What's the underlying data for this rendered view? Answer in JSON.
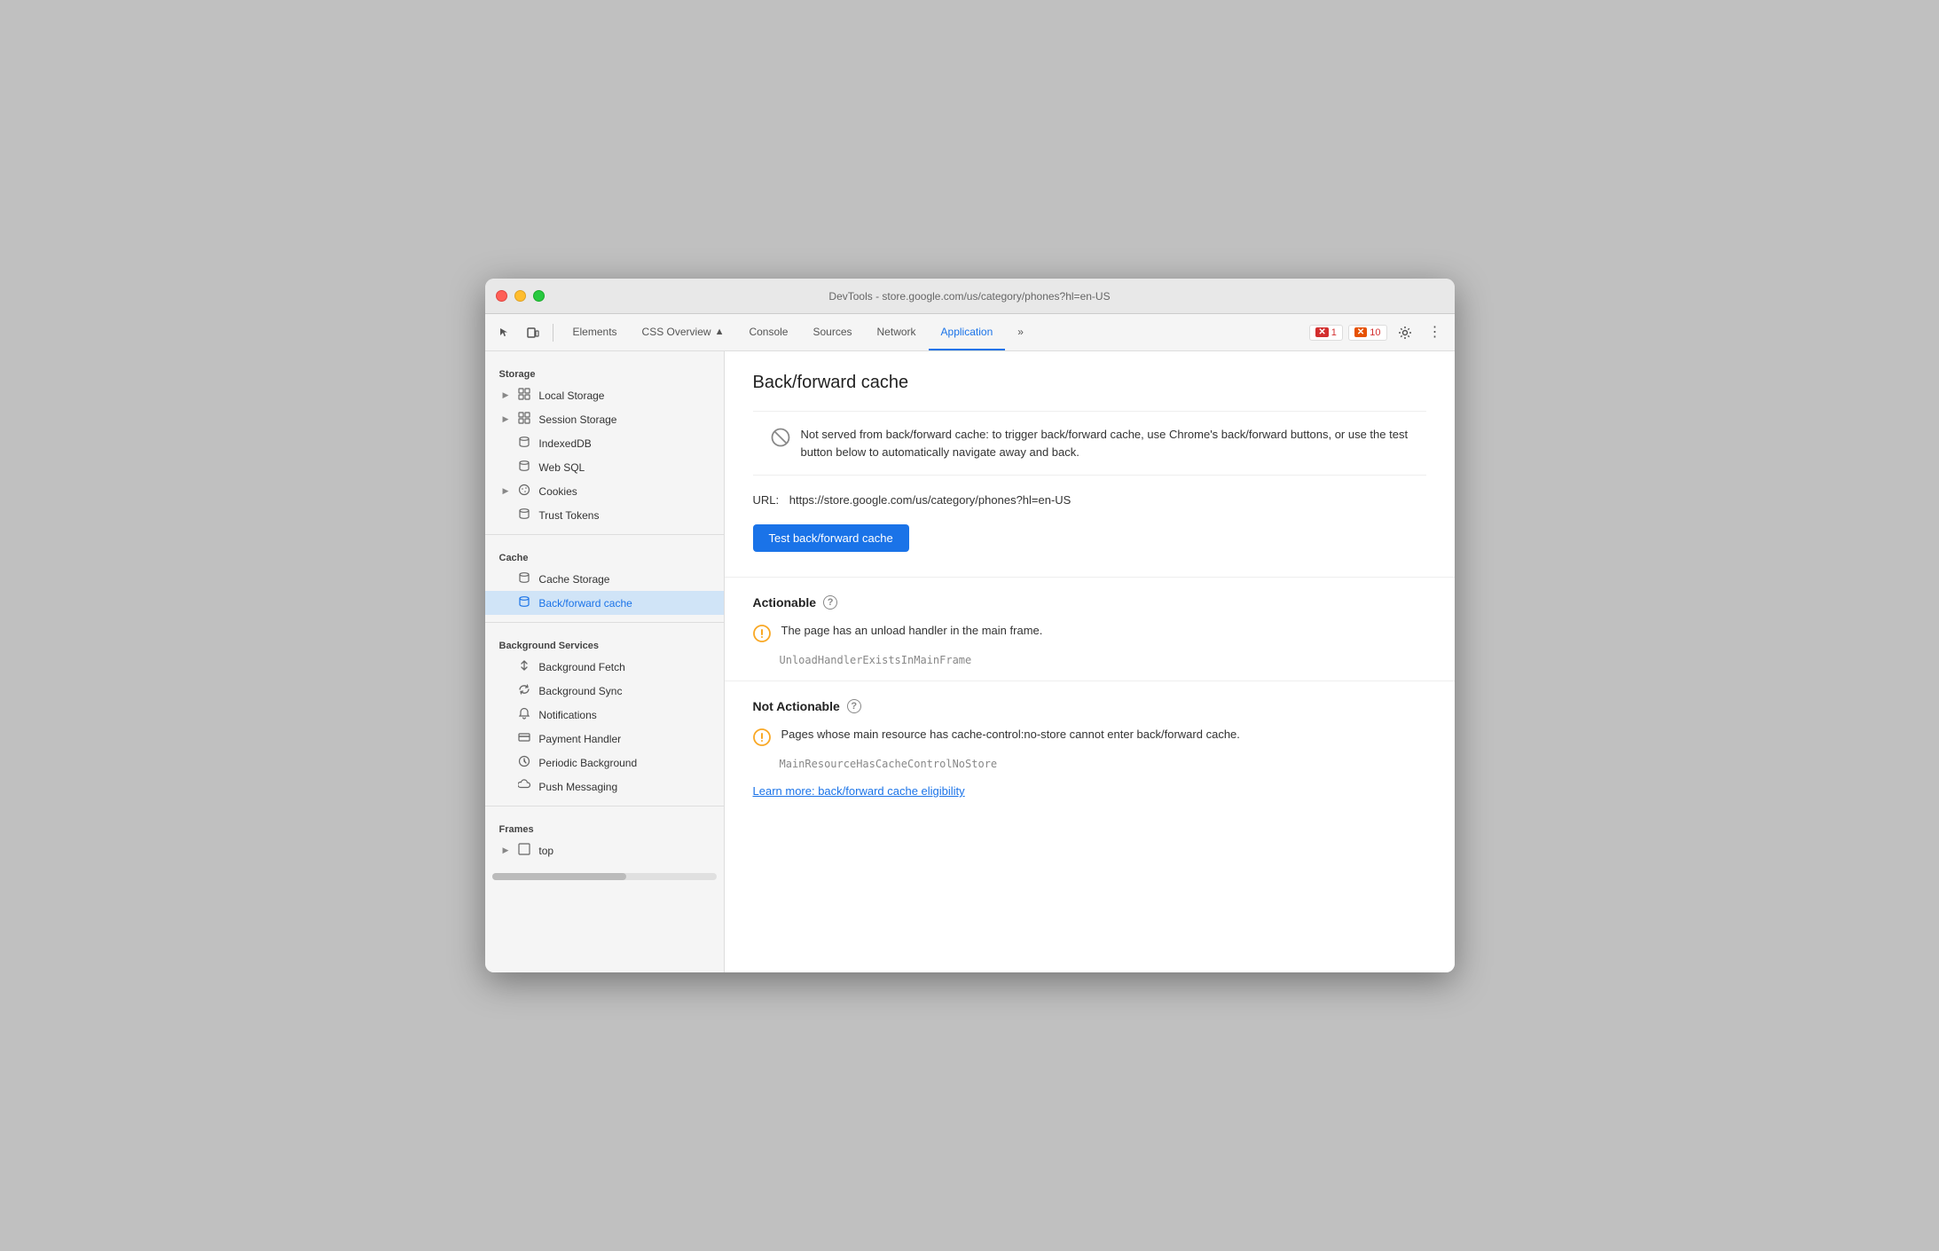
{
  "window": {
    "title": "DevTools - store.google.com/us/category/phones?hl=en-US"
  },
  "toolbar": {
    "tabs": [
      {
        "id": "elements",
        "label": "Elements",
        "active": false
      },
      {
        "id": "css-overview",
        "label": "CSS Overview",
        "active": false
      },
      {
        "id": "console",
        "label": "Console",
        "active": false
      },
      {
        "id": "sources",
        "label": "Sources",
        "active": false
      },
      {
        "id": "network",
        "label": "Network",
        "active": false
      },
      {
        "id": "application",
        "label": "Application",
        "active": true
      }
    ],
    "error_count": "1",
    "warning_count": "10",
    "more_label": "»"
  },
  "sidebar": {
    "storage_label": "Storage",
    "items": [
      {
        "id": "local-storage",
        "label": "Local Storage",
        "icon": "grid",
        "expandable": true
      },
      {
        "id": "session-storage",
        "label": "Session Storage",
        "icon": "grid",
        "expandable": true
      },
      {
        "id": "indexeddb",
        "label": "IndexedDB",
        "icon": "cylinder",
        "expandable": false
      },
      {
        "id": "web-sql",
        "label": "Web SQL",
        "icon": "cylinder",
        "expandable": false
      },
      {
        "id": "cookies",
        "label": "Cookies",
        "icon": "cookie",
        "expandable": true
      },
      {
        "id": "trust-tokens",
        "label": "Trust Tokens",
        "icon": "cylinder",
        "expandable": false
      }
    ],
    "cache_label": "Cache",
    "cache_items": [
      {
        "id": "cache-storage",
        "label": "Cache Storage",
        "icon": "cylinder",
        "active": false
      },
      {
        "id": "back-forward-cache",
        "label": "Back/forward cache",
        "icon": "cylinder",
        "active": true
      }
    ],
    "bg_services_label": "Background Services",
    "bg_items": [
      {
        "id": "background-fetch",
        "label": "Background Fetch",
        "icon": "arrows"
      },
      {
        "id": "background-sync",
        "label": "Background Sync",
        "icon": "sync"
      },
      {
        "id": "notifications",
        "label": "Notifications",
        "icon": "bell"
      },
      {
        "id": "payment-handler",
        "label": "Payment Handler",
        "icon": "card"
      },
      {
        "id": "periodic-background",
        "label": "Periodic Background",
        "icon": "clock"
      },
      {
        "id": "push-messaging",
        "label": "Push Messaging",
        "icon": "cloud"
      }
    ],
    "frames_label": "Frames",
    "frames_items": [
      {
        "id": "top",
        "label": "top",
        "expandable": true
      }
    ]
  },
  "content": {
    "title": "Back/forward cache",
    "info_text": "Not served from back/forward cache: to trigger back/forward cache, use Chrome's back/forward buttons, or use the test button below to automatically navigate away and back.",
    "url_label": "URL:",
    "url": "https://store.google.com/us/category/phones?hl=en-US",
    "test_button_label": "Test back/forward cache",
    "actionable_label": "Actionable",
    "actionable_issue": "The page has an unload handler in the main frame.",
    "actionable_code": "UnloadHandlerExistsInMainFrame",
    "not_actionable_label": "Not Actionable",
    "not_actionable_issue": "Pages whose main resource has cache-control:no-store cannot enter back/forward cache.",
    "not_actionable_code": "MainResourceHasCacheControlNoStore",
    "learn_more": "Learn more: back/forward cache eligibility"
  }
}
